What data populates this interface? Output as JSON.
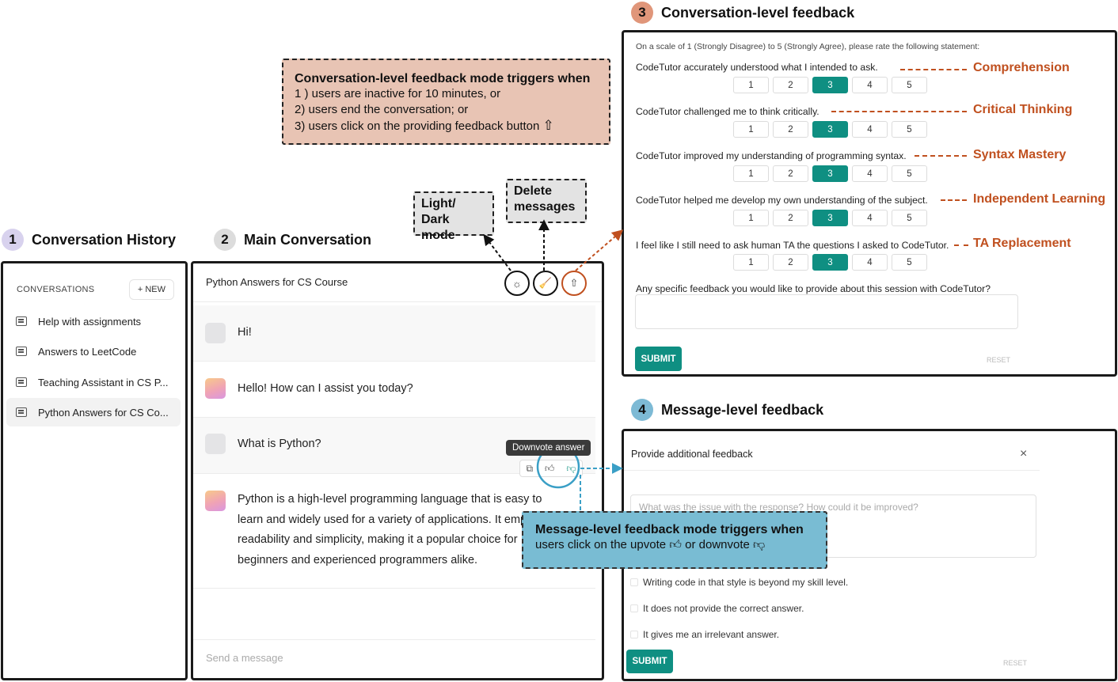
{
  "sections": {
    "history": {
      "num": "1",
      "title": "Conversation History"
    },
    "main": {
      "num": "2",
      "title": "Main Conversation"
    },
    "conv_feedback": {
      "num": "3",
      "title": "Conversation-level feedback"
    },
    "msg_feedback": {
      "num": "4",
      "title": "Message-level feedback"
    }
  },
  "history": {
    "header": "CONVERSATIONS",
    "new_button": "+ NEW",
    "items": [
      "Help with assignments",
      "Answers to LeetCode",
      "Teaching Assistant in CS P...",
      "Python Answers for CS Co..."
    ]
  },
  "main": {
    "title": "Python Answers for CS Course",
    "messages": [
      {
        "role": "user",
        "text": "Hi!"
      },
      {
        "role": "bot",
        "text": "Hello! How can I assist you today?"
      },
      {
        "role": "user",
        "text": "What is Python?"
      },
      {
        "role": "bot",
        "lines": [
          "Python is a high-level programming language that is easy to",
          "learn and widely used for a variety of applications. It emphasizes",
          "readability and simplicity, making it a popular choice for",
          "beginners and experienced programmers alike."
        ]
      }
    ],
    "tooltip": "Downvote answer",
    "input_placeholder": "Send a message",
    "icons": [
      "sun-icon",
      "broom-icon",
      "upload-icon"
    ]
  },
  "callouts": {
    "conv_trigger": {
      "title": "Conversation-level feedback mode triggers when",
      "lines": [
        "1 ) users are inactive for 10 minutes, or",
        "2) users end the conversation; or",
        "3) users click on the providing feedback button"
      ]
    },
    "light_dark": [
      "Light/ Dark",
      "mode"
    ],
    "delete": [
      "Delete",
      "messages"
    ],
    "msg_trigger": {
      "title": "Message-level feedback mode triggers when",
      "line_a": "users click on the upvote",
      "line_b": "or downvote"
    }
  },
  "conv_feedback": {
    "intro": "On a scale of 1 (Strongly Disagree) to 5 (Strongly Agree), please rate the following statement:",
    "scale": [
      "1",
      "2",
      "3",
      "4",
      "5"
    ],
    "selected": 3,
    "questions": [
      {
        "text": "CodeTutor accurately understood what I intended to ask.",
        "label": "Comprehension"
      },
      {
        "text": "CodeTutor challenged me to think critically.",
        "label": "Critical Thinking"
      },
      {
        "text": "CodeTutor improved my understanding of programming syntax.",
        "label": "Syntax Mastery"
      },
      {
        "text": "CodeTutor helped me develop my own understanding of the subject.",
        "label": "Independent Learning"
      },
      {
        "text": "I feel like I still need to ask human TA the questions I asked to CodeTutor.",
        "label": "TA Replacement"
      }
    ],
    "open_question": "Any specific feedback you would like to provide about this session with CodeTutor?",
    "submit": "SUBMIT",
    "reset": "RESET"
  },
  "msg_feedback": {
    "title": "Provide additional feedback",
    "placeholder": "What was the issue with the response? How could it be improved?",
    "options": [
      "Writing code in that style is beyond my skill level.",
      "It does not provide the correct answer.",
      "It gives me an irrelevant answer."
    ],
    "submit": "SUBMIT",
    "reset": "RESET"
  },
  "colors": {
    "accent": "#0f8f82",
    "annotation": "#c0501f",
    "callout_salmon": "#e8c4b4",
    "callout_blue": "#79bcd3"
  }
}
